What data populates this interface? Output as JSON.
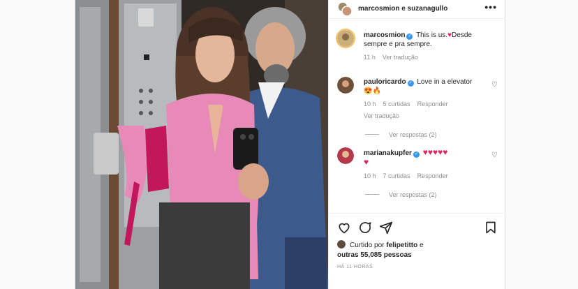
{
  "header": {
    "title": "marcosmion e suzanagullo",
    "more_icon": "more-horizontal-icon"
  },
  "caption": {
    "user": "marcosmion",
    "text": "This is us.",
    "text2": "Desde sempre e pra sempre.",
    "time": "11 h",
    "translate": "Ver tradução"
  },
  "comments": [
    {
      "user": "pauloricardo",
      "text": "Love in a elevator",
      "time": "10 h",
      "likes": "5 curtidas",
      "reply": "Responder",
      "translate": "Ver tradução",
      "view_replies": "Ver respostas (2)"
    },
    {
      "user": "marianakupfer",
      "time": "10 h",
      "likes": "7 curtidas",
      "reply": "Responder",
      "view_replies": "Ver respostas (2)"
    }
  ],
  "liked_by": {
    "prefix": "Curtido por",
    "user": "felipetitto",
    "middle": "e",
    "others": "outras 55,085 pessoas"
  },
  "timestamp": "HÁ 11 HORAS",
  "colors": {
    "pink_shirt": "#e88ab8",
    "heart": "#e0245e",
    "verified": "#3897f0",
    "muted": "#8e8e8e"
  }
}
